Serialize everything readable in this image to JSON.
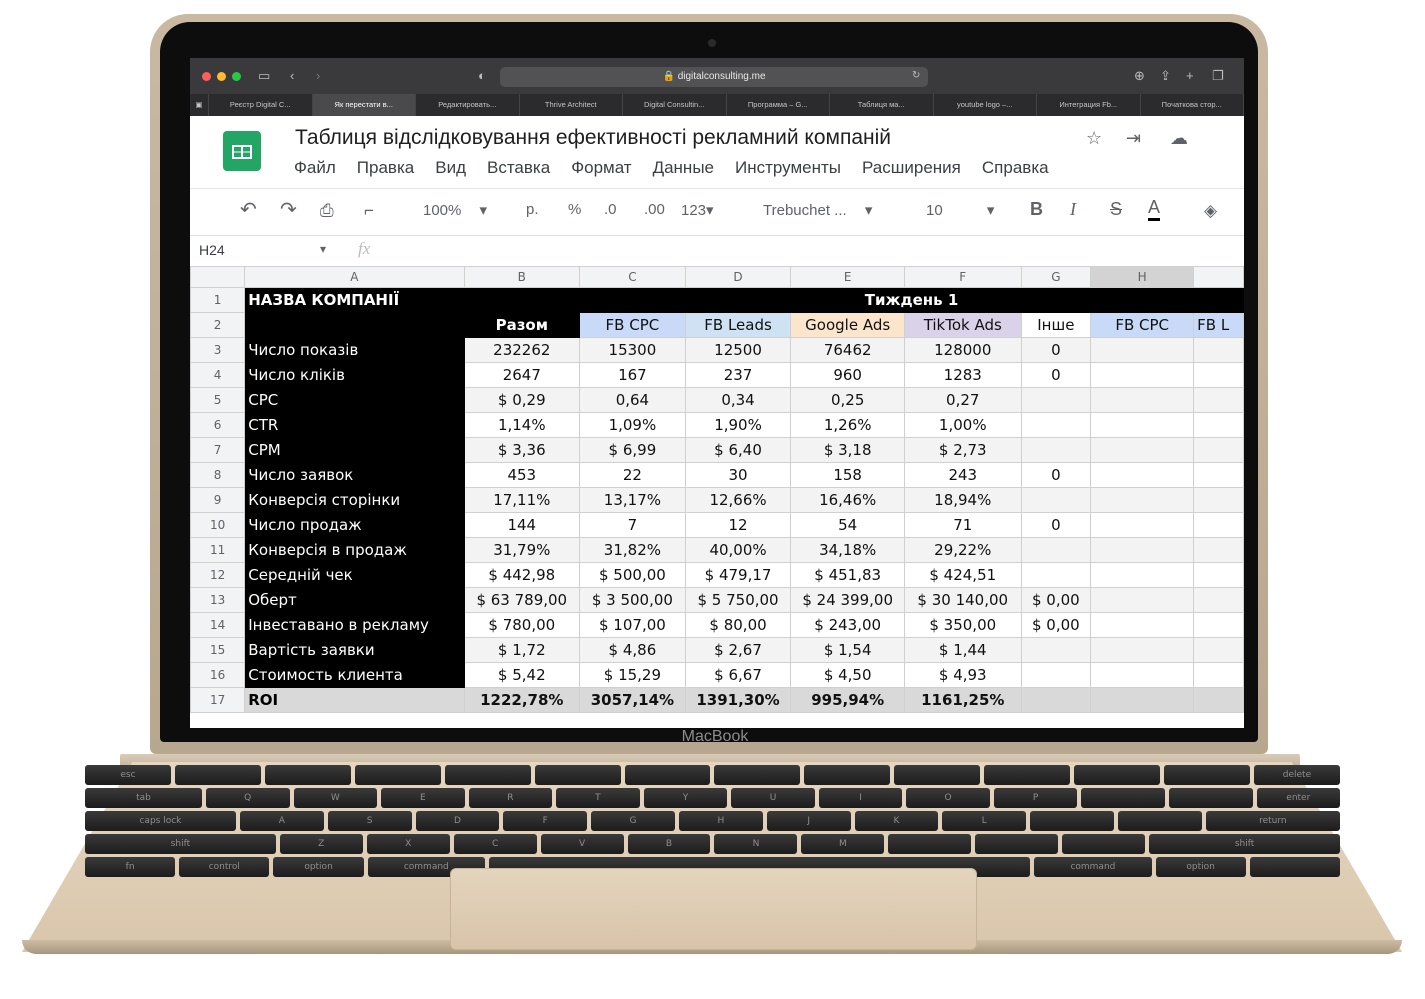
{
  "device": {
    "brand": "MacBook"
  },
  "browser": {
    "url": "digitalconsulting.me",
    "tabs": [
      "Реєстр Digital C...",
      "Як перестати в...",
      "Редактировать...",
      "Thrive Architect",
      "Digital Consultin...",
      "Программа – G...",
      "Таблиця ма...",
      "youtube logo –...",
      "Интеграция Fb...",
      "Початкова стор..."
    ],
    "active_tab": 1
  },
  "doc": {
    "title": "Таблиця відслідковування ефективності рекламний компаній",
    "menu": [
      "Файл",
      "Правка",
      "Вид",
      "Вставка",
      "Формат",
      "Данные",
      "Инструменты",
      "Расширения",
      "Справка"
    ]
  },
  "toolbar": {
    "zoom": "100%",
    "currency": "р.",
    "percent": "%",
    "dec_less": ".0",
    "dec_more": ".00",
    "number_format": "123",
    "font": "Trebuchet ...",
    "font_size": "10",
    "bold": "B",
    "italic": "I",
    "strike": "S",
    "text_color": "A"
  },
  "formula_bar": {
    "cell": "H24",
    "fx": "fx"
  },
  "sheet": {
    "columns": [
      "A",
      "B",
      "C",
      "D",
      "E",
      "F",
      "G",
      "H"
    ],
    "row1": {
      "company_label": "НАЗВА КОМПАНІЇ",
      "week": "Тиждень 1"
    },
    "row2": {
      "total": "Разом",
      "fb_cpc": "FB CPC",
      "fb_leads": "FB Leads",
      "google": "Google Ads",
      "tiktok": "TikTok Ads",
      "other": "Інше",
      "fb_cpc2": "FB CPC",
      "fb_l": "FB L"
    },
    "rows": [
      {
        "n": "3",
        "label": "Число показів",
        "cells": [
          "232262",
          "15300",
          "12500",
          "76462",
          "128000",
          "0",
          ""
        ]
      },
      {
        "n": "4",
        "label": "Число кліків",
        "cells": [
          "2647",
          "167",
          "237",
          "960",
          "1283",
          "0",
          ""
        ]
      },
      {
        "n": "5",
        "label": "CPC",
        "cells": [
          "$ 0,29",
          "0,64",
          "0,34",
          "0,25",
          "0,27",
          "",
          ""
        ]
      },
      {
        "n": "6",
        "label": "CTR",
        "cells": [
          "1,14%",
          "1,09%",
          "1,90%",
          "1,26%",
          "1,00%",
          "",
          ""
        ]
      },
      {
        "n": "7",
        "label": "CPM",
        "cells": [
          "$ 3,36",
          "$ 6,99",
          "$ 6,40",
          "$ 3,18",
          "$ 2,73",
          "",
          ""
        ]
      },
      {
        "n": "8",
        "label": "Число заявок",
        "cells": [
          "453",
          "22",
          "30",
          "158",
          "243",
          "0",
          ""
        ]
      },
      {
        "n": "9",
        "label": "Конверсія сторінки",
        "cells": [
          "17,11%",
          "13,17%",
          "12,66%",
          "16,46%",
          "18,94%",
          "",
          ""
        ]
      },
      {
        "n": "10",
        "label": "Число продаж",
        "cells": [
          "144",
          "7",
          "12",
          "54",
          "71",
          "0",
          ""
        ]
      },
      {
        "n": "11",
        "label": "Конверсія в продаж",
        "cells": [
          "31,79%",
          "31,82%",
          "40,00%",
          "34,18%",
          "29,22%",
          "",
          ""
        ]
      },
      {
        "n": "12",
        "label": "Середній чек",
        "cells": [
          "$ 442,98",
          "$ 500,00",
          "$ 479,17",
          "$ 451,83",
          "$ 424,51",
          "",
          ""
        ]
      },
      {
        "n": "13",
        "label": "Оберт",
        "cells": [
          "$ 63 789,00",
          "$ 3 500,00",
          "$ 5 750,00",
          "$ 24 399,00",
          "$ 30 140,00",
          "$ 0,00",
          ""
        ]
      },
      {
        "n": "14",
        "label": "Інвеставано в рекламу",
        "cells": [
          "$ 780,00",
          "$ 107,00",
          "$ 80,00",
          "$ 243,00",
          "$ 350,00",
          "$ 0,00",
          ""
        ]
      },
      {
        "n": "15",
        "label": "Вартість заявки",
        "cells": [
          "$ 1,72",
          "$ 4,86",
          "$ 2,67",
          "$ 1,54",
          "$ 1,44",
          "",
          ""
        ]
      },
      {
        "n": "16",
        "label": "Стоимость клиента",
        "cells": [
          "$ 5,42",
          "$ 15,29",
          "$ 6,67",
          "$ 4,50",
          "$ 4,93",
          "",
          ""
        ]
      }
    ],
    "roi": {
      "n": "17",
      "label": "ROI",
      "cells": [
        "1222,78%",
        "3057,14%",
        "1391,30%",
        "995,94%",
        "1161,25%",
        "",
        ""
      ]
    },
    "row_numbers": {
      "r1": "1",
      "r2": "2"
    }
  },
  "keyboard_labels": [
    "esc",
    "tab",
    "caps lock",
    "shift",
    "fn",
    "control",
    "option",
    "command",
    "Q",
    "W",
    "E",
    "R",
    "T",
    "Y",
    "U",
    "I",
    "O",
    "P",
    "A",
    "S",
    "D",
    "F",
    "G",
    "H",
    "J",
    "K",
    "L",
    "Z",
    "X",
    "C",
    "V",
    "B",
    "N",
    "M",
    "delete",
    "enter",
    "return",
    "shift",
    "command",
    "option"
  ]
}
